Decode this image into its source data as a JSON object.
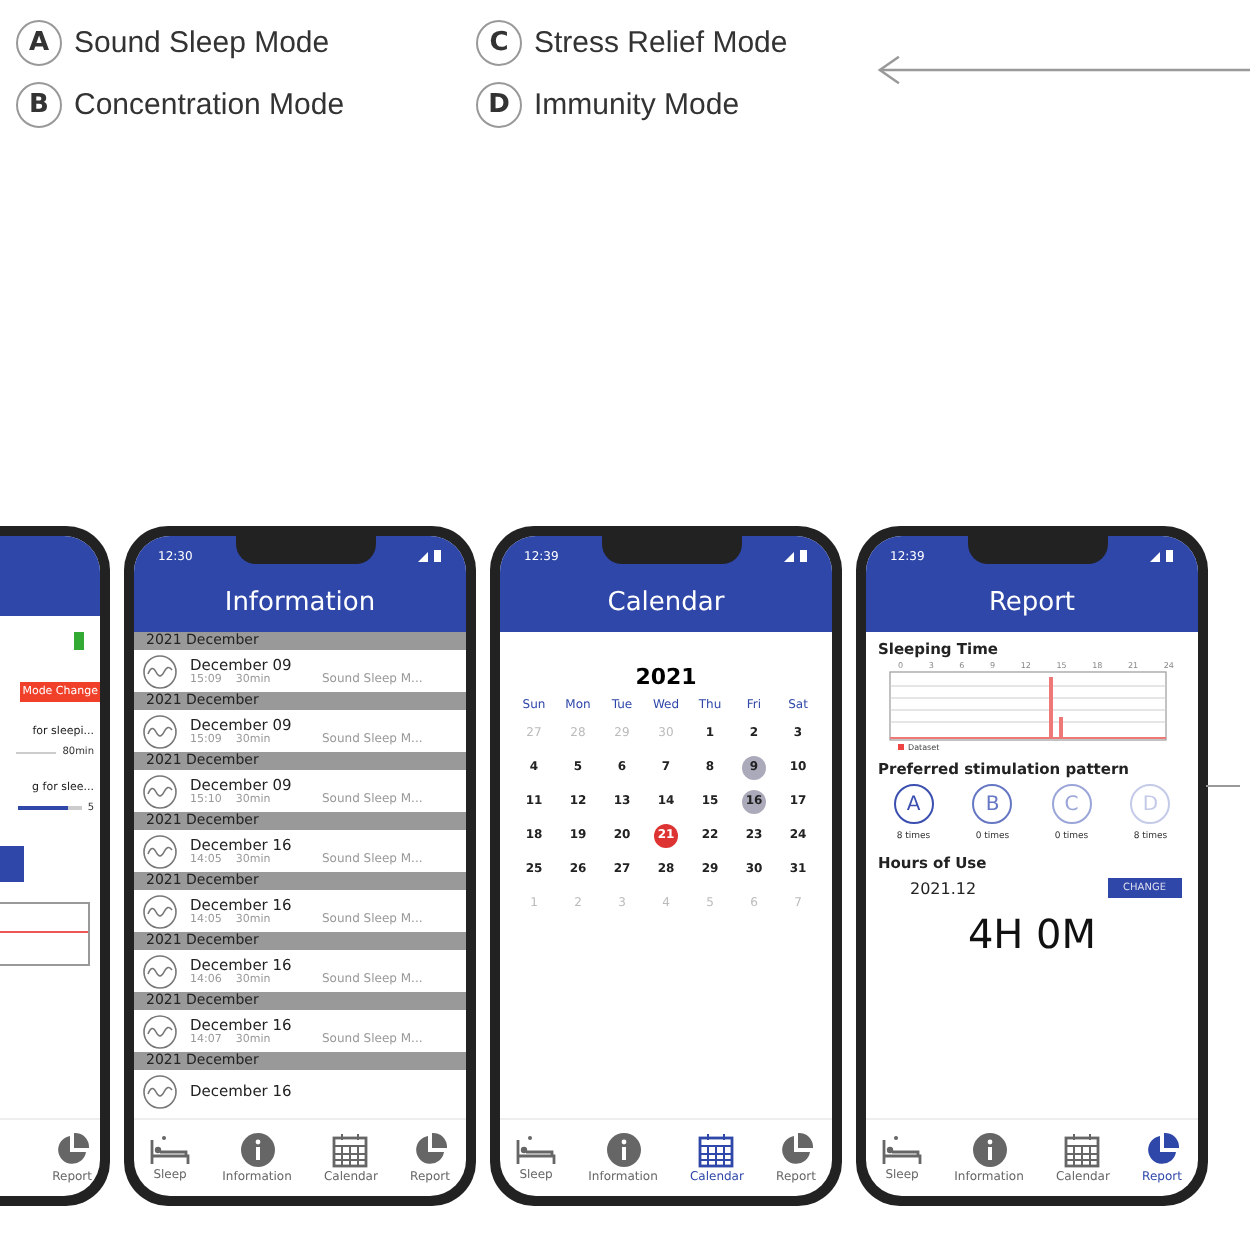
{
  "legend": [
    {
      "letter": "A",
      "label": "Sound Sleep Mode"
    },
    {
      "letter": "C",
      "label": "Stress Relief Mode"
    },
    {
      "letter": "B",
      "label": "Concentration Mode"
    },
    {
      "letter": "D",
      "label": "Immunity Mode"
    }
  ],
  "phones": [
    {
      "kind": "settings",
      "mode_button": "Mode Change",
      "setting_1": "for sleepi...",
      "setting_1_value": "80min",
      "setting_2": "g for slee...",
      "setting_2_value": "5",
      "level": 0.8,
      "tabs": [
        {
          "label": "Report",
          "kind": "report",
          "selected": false
        }
      ]
    },
    {
      "kind": "information",
      "status_time": "12:30",
      "title": "Information",
      "rows": [
        {
          "group": "2021 December",
          "date": "December 09",
          "time": "15:09",
          "duration": "30min",
          "mode": "Sound Sleep M..."
        },
        {
          "group": "2021 December",
          "date": "December 09",
          "time": "15:09",
          "duration": "30min",
          "mode": "Sound Sleep M..."
        },
        {
          "group": "2021 December",
          "date": "December 09",
          "time": "15:10",
          "duration": "30min",
          "mode": "Sound Sleep M..."
        },
        {
          "group": "2021 December",
          "date": "December 16",
          "time": "14:05",
          "duration": "30min",
          "mode": "Sound Sleep M..."
        },
        {
          "group": "2021 December",
          "date": "December 16",
          "time": "14:05",
          "duration": "30min",
          "mode": "Sound Sleep M..."
        },
        {
          "group": "2021 December",
          "date": "December 16",
          "time": "14:06",
          "duration": "30min",
          "mode": "Sound Sleep M..."
        },
        {
          "group": "2021 December",
          "date": "December 16",
          "time": "14:07",
          "duration": "30min",
          "mode": "Sound Sleep M..."
        },
        {
          "group": "2021 December",
          "date": "December 16"
        }
      ],
      "tabs": [
        {
          "label": "Sleep",
          "kind": "sleep",
          "selected": false
        },
        {
          "label": "Information",
          "kind": "information",
          "selected": false
        },
        {
          "label": "Calendar",
          "kind": "calendar",
          "selected": false
        },
        {
          "label": "Report",
          "kind": "report",
          "selected": false
        }
      ]
    },
    {
      "kind": "calendar",
      "status_time": "12:39",
      "title": "Calendar",
      "year": "2021",
      "weekdays": [
        "Sun",
        "Mon",
        "Tue",
        "Wed",
        "Thu",
        "Fri",
        "Sat"
      ],
      "days": [
        {
          "day": "27",
          "kind": "other"
        },
        {
          "day": "28",
          "kind": "other"
        },
        {
          "day": "29",
          "kind": "other"
        },
        {
          "day": "30",
          "kind": "other"
        },
        {
          "day": "1",
          "kind": "normal"
        },
        {
          "day": "2",
          "kind": "normal"
        },
        {
          "day": "3",
          "kind": "normal"
        },
        {
          "day": "4",
          "kind": "normal"
        },
        {
          "day": "5",
          "kind": "normal"
        },
        {
          "day": "6",
          "kind": "normal"
        },
        {
          "day": "7",
          "kind": "normal"
        },
        {
          "day": "8",
          "kind": "normal"
        },
        {
          "day": "9",
          "kind": "marked"
        },
        {
          "day": "10",
          "kind": "normal"
        },
        {
          "day": "11",
          "kind": "normal"
        },
        {
          "day": "12",
          "kind": "normal"
        },
        {
          "day": "13",
          "kind": "normal"
        },
        {
          "day": "14",
          "kind": "normal"
        },
        {
          "day": "15",
          "kind": "normal"
        },
        {
          "day": "16",
          "kind": "marked"
        },
        {
          "day": "17",
          "kind": "normal"
        },
        {
          "day": "18",
          "kind": "normal"
        },
        {
          "day": "19",
          "kind": "normal"
        },
        {
          "day": "20",
          "kind": "normal"
        },
        {
          "day": "21",
          "kind": "today"
        },
        {
          "day": "22",
          "kind": "normal"
        },
        {
          "day": "23",
          "kind": "normal"
        },
        {
          "day": "24",
          "kind": "normal"
        },
        {
          "day": "25",
          "kind": "normal"
        },
        {
          "day": "26",
          "kind": "normal"
        },
        {
          "day": "27",
          "kind": "normal"
        },
        {
          "day": "28",
          "kind": "normal"
        },
        {
          "day": "29",
          "kind": "normal"
        },
        {
          "day": "30",
          "kind": "normal"
        },
        {
          "day": "31",
          "kind": "normal"
        },
        {
          "day": "1",
          "kind": "other"
        },
        {
          "day": "2",
          "kind": "other"
        },
        {
          "day": "3",
          "kind": "other"
        },
        {
          "day": "4",
          "kind": "other"
        },
        {
          "day": "5",
          "kind": "other"
        },
        {
          "day": "6",
          "kind": "other"
        },
        {
          "day": "7",
          "kind": "other"
        }
      ],
      "tabs": [
        {
          "label": "Sleep",
          "kind": "sleep",
          "selected": false
        },
        {
          "label": "Information",
          "kind": "information",
          "selected": false
        },
        {
          "label": "Calendar",
          "kind": "calendar",
          "selected": true
        },
        {
          "label": "Report",
          "kind": "report",
          "selected": false
        }
      ]
    },
    {
      "kind": "report",
      "status_time": "12:39",
      "title": "Report",
      "sleeping_title": "Sleeping Time",
      "chart_ticks": [
        "0",
        "3",
        "6",
        "9",
        "12",
        "15",
        "18",
        "21",
        "24"
      ],
      "chart_legend": "Dataset",
      "pattern_title": "Preferred stimulation pattern",
      "patterns": [
        {
          "letter": "A",
          "count": "8 times",
          "color": "#3a4fb0"
        },
        {
          "letter": "B",
          "count": "0 times",
          "color": "#6677c4"
        },
        {
          "letter": "C",
          "count": "0 times",
          "color": "#9aa5d8"
        },
        {
          "letter": "D",
          "count": "8 times",
          "color": "#c4cbe8"
        }
      ],
      "hours_title": "Hours of Use",
      "month": "2021.12",
      "change_button": "CHANGE",
      "total": "4H 0M",
      "tabs": [
        {
          "label": "Sleep",
          "kind": "sleep",
          "selected": false
        },
        {
          "label": "Information",
          "kind": "information",
          "selected": false
        },
        {
          "label": "Calendar",
          "kind": "calendar",
          "selected": false
        },
        {
          "label": "Report",
          "kind": "report",
          "selected": true
        }
      ]
    }
  ]
}
